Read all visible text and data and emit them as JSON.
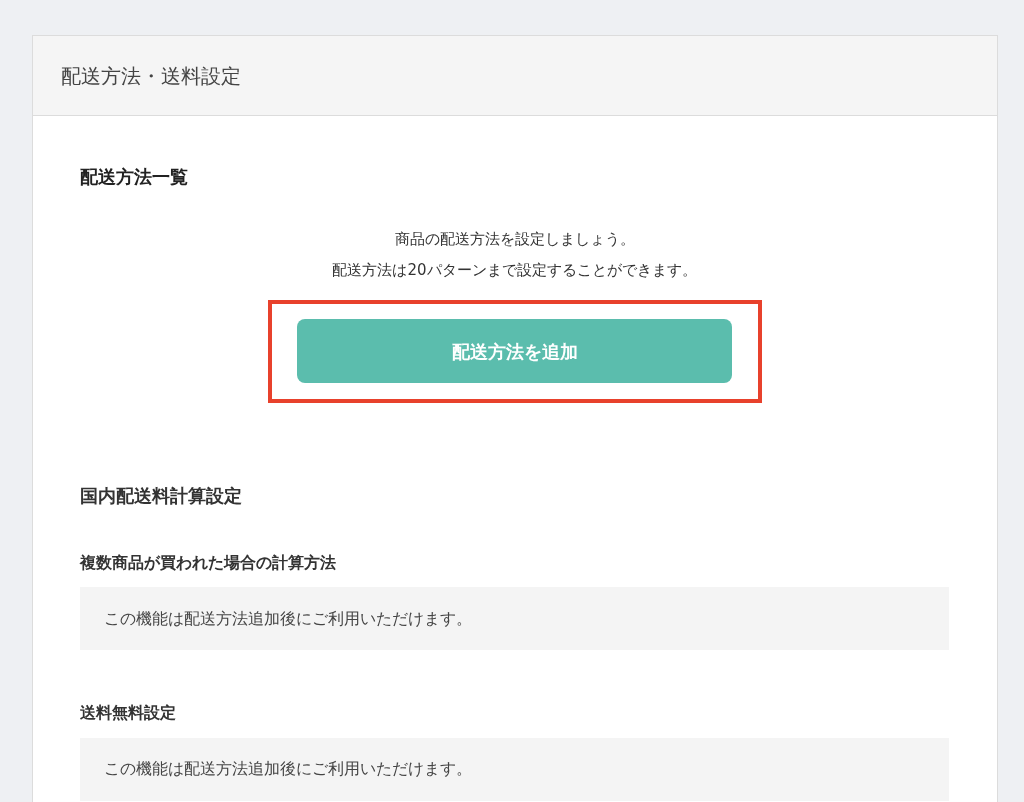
{
  "card_title": "配送方法・送料設定",
  "shipping_list": {
    "title": "配送方法一覧",
    "intro_lines": [
      "商品の配送方法を設定しましょう。",
      "配送方法は20パターンまで設定することができます。"
    ],
    "add_button": {
      "label": "配送方法を追加",
      "highlighted": true
    }
  },
  "domestic": {
    "title": "国内配送料計算設定",
    "settings": [
      {
        "label": "複数商品が買われた場合の計算方法",
        "notice": "この機能は配送方法追加後にご利用いただけます。"
      },
      {
        "label": "送料無料設定",
        "notice": "この機能は配送方法追加後にご利用いただけます。"
      }
    ]
  }
}
